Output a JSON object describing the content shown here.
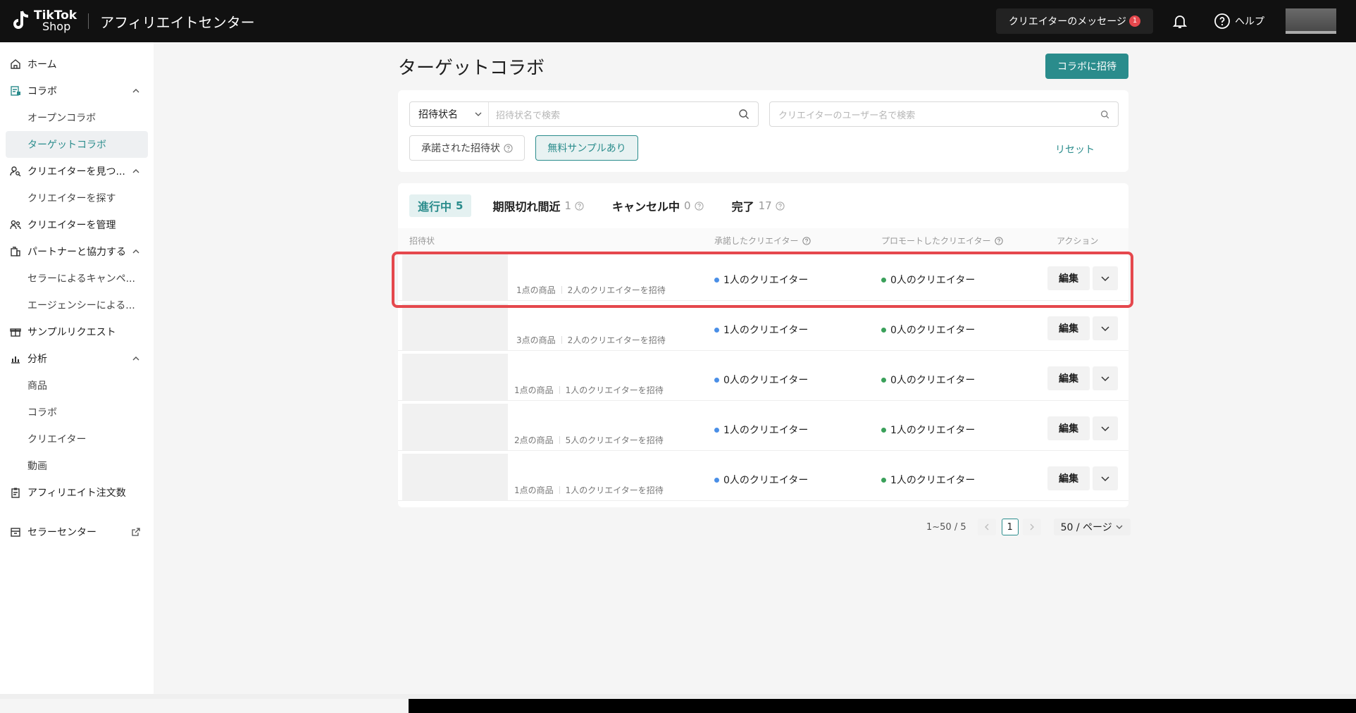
{
  "header": {
    "logo_line1": "TikTok",
    "logo_line2": "Shop",
    "app_title": "アフィリエイトセンター",
    "messages_label": "クリエイターのメッセージ",
    "messages_badge": "1",
    "help_label": "ヘルプ"
  },
  "sidebar": {
    "home": "ホーム",
    "collab": "コラボ",
    "open_collab": "オープンコラボ",
    "target_collab": "ターゲットコラボ",
    "find_creators": "クリエイターを見つ...",
    "search_creators": "クリエイターを探す",
    "manage_creators": "クリエイターを管理",
    "partners": "パートナーと協力する",
    "seller_campaign": "セラーによるキャンペ...",
    "agency": "エージェンシーによる...",
    "sample_requests": "サンプルリクエスト",
    "analytics": "分析",
    "products": "商品",
    "collab_analytics": "コラボ",
    "creators": "クリエイター",
    "videos": "動画",
    "affiliate_orders": "アフィリエイト注文数",
    "seller_center": "セラーセンター"
  },
  "main": {
    "title": "ターゲットコラボ",
    "invite_button": "コラボに招待",
    "filter": {
      "select_value": "招待状名",
      "select_placeholder": "招待状名で検索",
      "creator_placeholder": "クリエイターのユーザー名で検索",
      "chip_accepted": "承諾された招待状",
      "chip_free_sample": "無料サンプルあり",
      "reset": "リセット"
    },
    "tabs": [
      {
        "label": "進行中",
        "count": "5"
      },
      {
        "label": "期限切れ間近",
        "count": "1"
      },
      {
        "label": "キャンセル中",
        "count": "0"
      },
      {
        "label": "完了",
        "count": "17"
      }
    ],
    "columns": {
      "invitation": "招待状",
      "accepted": "承諾したクリエイター",
      "promoted": "プロモートしたクリエイター",
      "action": "アクション"
    },
    "rows": [
      {
        "products": "1点の商品",
        "invited": "2人のクリエイターを招待",
        "accepted": "1人のクリエイター",
        "promoted": "0人のクリエイター",
        "edit": "編集"
      },
      {
        "products": "3点の商品",
        "invited": "2人のクリエイターを招待",
        "accepted": "1人のクリエイター",
        "promoted": "0人のクリエイター",
        "edit": "編集"
      },
      {
        "products": "1点の商品",
        "invited": "1人のクリエイターを招待",
        "accepted": "0人のクリエイター",
        "promoted": "0人のクリエイター",
        "edit": "編集"
      },
      {
        "products": "2点の商品",
        "invited": "5人のクリエイターを招待",
        "accepted": "1人のクリエイター",
        "promoted": "1人のクリエイター",
        "edit": "編集"
      },
      {
        "products": "1点の商品",
        "invited": "1人のクリエイターを招待",
        "accepted": "0人のクリエイター",
        "promoted": "1人のクリエイター",
        "edit": "編集"
      }
    ],
    "pagination": {
      "range": "1~50 / 5",
      "current_page": "1",
      "page_size": "50 / ページ"
    }
  },
  "colors": {
    "brand": "#2a8c8c",
    "accepted_dot": "#4a8fe7",
    "promoted_dot": "#3aa05a",
    "highlight": "#e5484d"
  }
}
